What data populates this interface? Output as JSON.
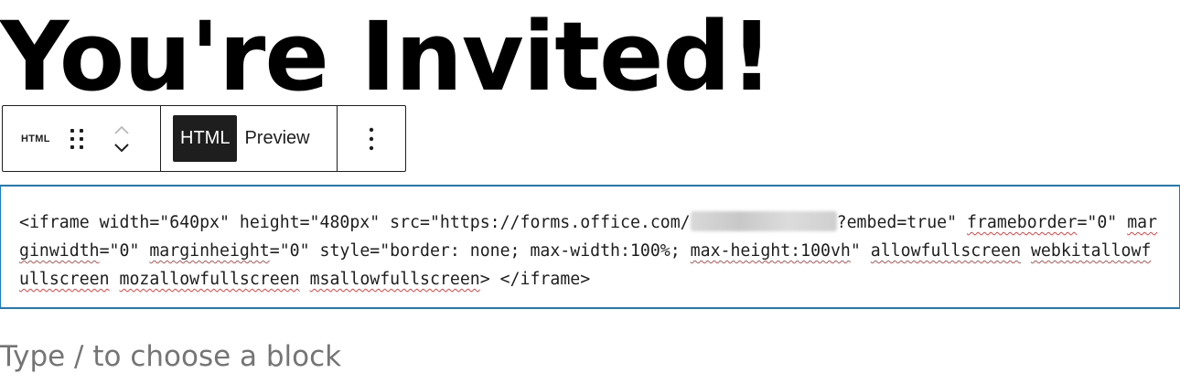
{
  "heading": {
    "text": "You're Invited!"
  },
  "toolbar": {
    "block_label": "HTML",
    "mode_html_label": "HTML",
    "mode_preview_label": "Preview",
    "active_mode": "HTML",
    "icons": {
      "drag": "drag-handle-icon",
      "move_up": "chevron-up-icon",
      "move_down": "chevron-down-icon",
      "more": "more-vertical-icon"
    }
  },
  "code_block": {
    "line1_part1": "<iframe width=\"640px\" height=\"480px\" src=\"https://forms.office.com/",
    "line1_part2": "?embed=true\" ",
    "w_frameborder": "frameborder",
    "p_frameborder": "=\"0\" ",
    "w_marginwidth": "marginwidth",
    "p_marginwidth": "=\"0\" ",
    "w_marginheight": "marginheight",
    "p_marginheight": "=\"0\" style=\"border: none; max-width:100%; ",
    "w_maxheight": "max-height:100vh",
    "p_maxheight": "\" ",
    "w_allowfullscreen": "allowfullscreen",
    "p_sp1": " ",
    "w_webkit": "webkitallowfullscreen",
    "p_sp2": " ",
    "w_moz": "mozallowfullscreen",
    "p_sp3": " ",
    "w_ms": "msallowfullscreen",
    "p_end": "> </iframe>"
  },
  "placeholder": {
    "text": "Type / to choose a block"
  },
  "colors": {
    "accent": "#1e7bb8",
    "toolbar_border": "#1e1e1e",
    "active_mode_bg": "#1e1e1e",
    "placeholder_text": "#757575",
    "spellcheck_underline": "#e04545"
  }
}
